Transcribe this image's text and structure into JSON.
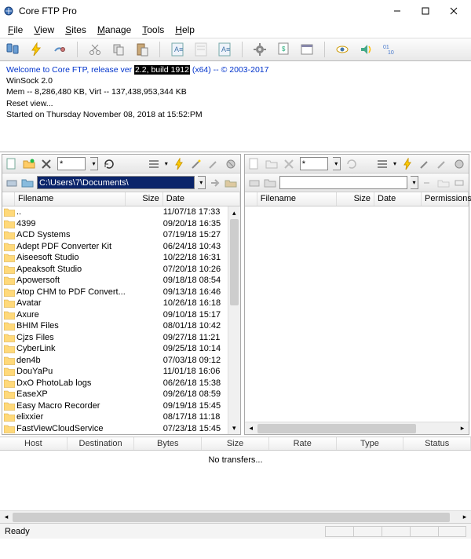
{
  "window": {
    "title": "Core FTP Pro"
  },
  "menu": {
    "file": "File",
    "view": "View",
    "sites": "Sites",
    "manage": "Manage",
    "tools": "Tools",
    "help": "Help"
  },
  "log": {
    "line1_prefix": "Welcome to Core FTP, release ver ",
    "line1_highlight": "2.2, build 1912",
    "line1_suffix": " (x64) -- © 2003-2017",
    "line2": "WinSock 2.0",
    "line3": "Mem -- 8,286,480 KB, Virt -- 137,438,953,344 KB",
    "line4": "Reset view...",
    "line5": "Started on Thursday November 08, 2018 at 15:52:PM"
  },
  "left": {
    "path": "C:\\Users\\7\\Documents\\",
    "columns": {
      "filename": "Filename",
      "size": "Size",
      "date": "Date"
    },
    "items": [
      {
        "name": "..",
        "size": "",
        "date": "11/07/18  17:33"
      },
      {
        "name": "4399",
        "size": "",
        "date": "09/20/18  16:35"
      },
      {
        "name": "ACD Systems",
        "size": "",
        "date": "07/19/18  15:27"
      },
      {
        "name": "Adept PDF Converter Kit",
        "size": "",
        "date": "06/24/18  10:43"
      },
      {
        "name": "Aiseesoft Studio",
        "size": "",
        "date": "10/22/18  16:31"
      },
      {
        "name": "Apeaksoft Studio",
        "size": "",
        "date": "07/20/18  10:26"
      },
      {
        "name": "Apowersoft",
        "size": "",
        "date": "09/18/18  08:54"
      },
      {
        "name": "Atop CHM to PDF Convert...",
        "size": "",
        "date": "09/13/18  16:46"
      },
      {
        "name": "Avatar",
        "size": "",
        "date": "10/26/18  16:18"
      },
      {
        "name": "Axure",
        "size": "",
        "date": "09/10/18  15:17"
      },
      {
        "name": "BHIM Files",
        "size": "",
        "date": "08/01/18  10:42"
      },
      {
        "name": "Cjzs Files",
        "size": "",
        "date": "09/27/18  11:21"
      },
      {
        "name": "CyberLink",
        "size": "",
        "date": "09/25/18  10:14"
      },
      {
        "name": "den4b",
        "size": "",
        "date": "07/03/18  09:12"
      },
      {
        "name": "DouYaPu",
        "size": "",
        "date": "11/01/18  16:06"
      },
      {
        "name": "DxO PhotoLab logs",
        "size": "",
        "date": "06/26/18  15:38"
      },
      {
        "name": "EaseXP",
        "size": "",
        "date": "09/26/18  08:59"
      },
      {
        "name": "Easy Macro Recorder",
        "size": "",
        "date": "09/19/18  15:45"
      },
      {
        "name": "elixxier",
        "size": "",
        "date": "08/17/18  11:18"
      },
      {
        "name": "FastViewCloudService",
        "size": "",
        "date": "07/23/18  15:45"
      }
    ]
  },
  "right": {
    "columns": {
      "filename": "Filename",
      "size": "Size",
      "date": "Date",
      "perm": "Permissions"
    }
  },
  "transfer": {
    "cols": {
      "host": "Host",
      "dest": "Destination",
      "bytes": "Bytes",
      "size": "Size",
      "rate": "Rate",
      "type": "Type",
      "status": "Status"
    },
    "empty": "No transfers..."
  },
  "status": {
    "text": "Ready"
  }
}
